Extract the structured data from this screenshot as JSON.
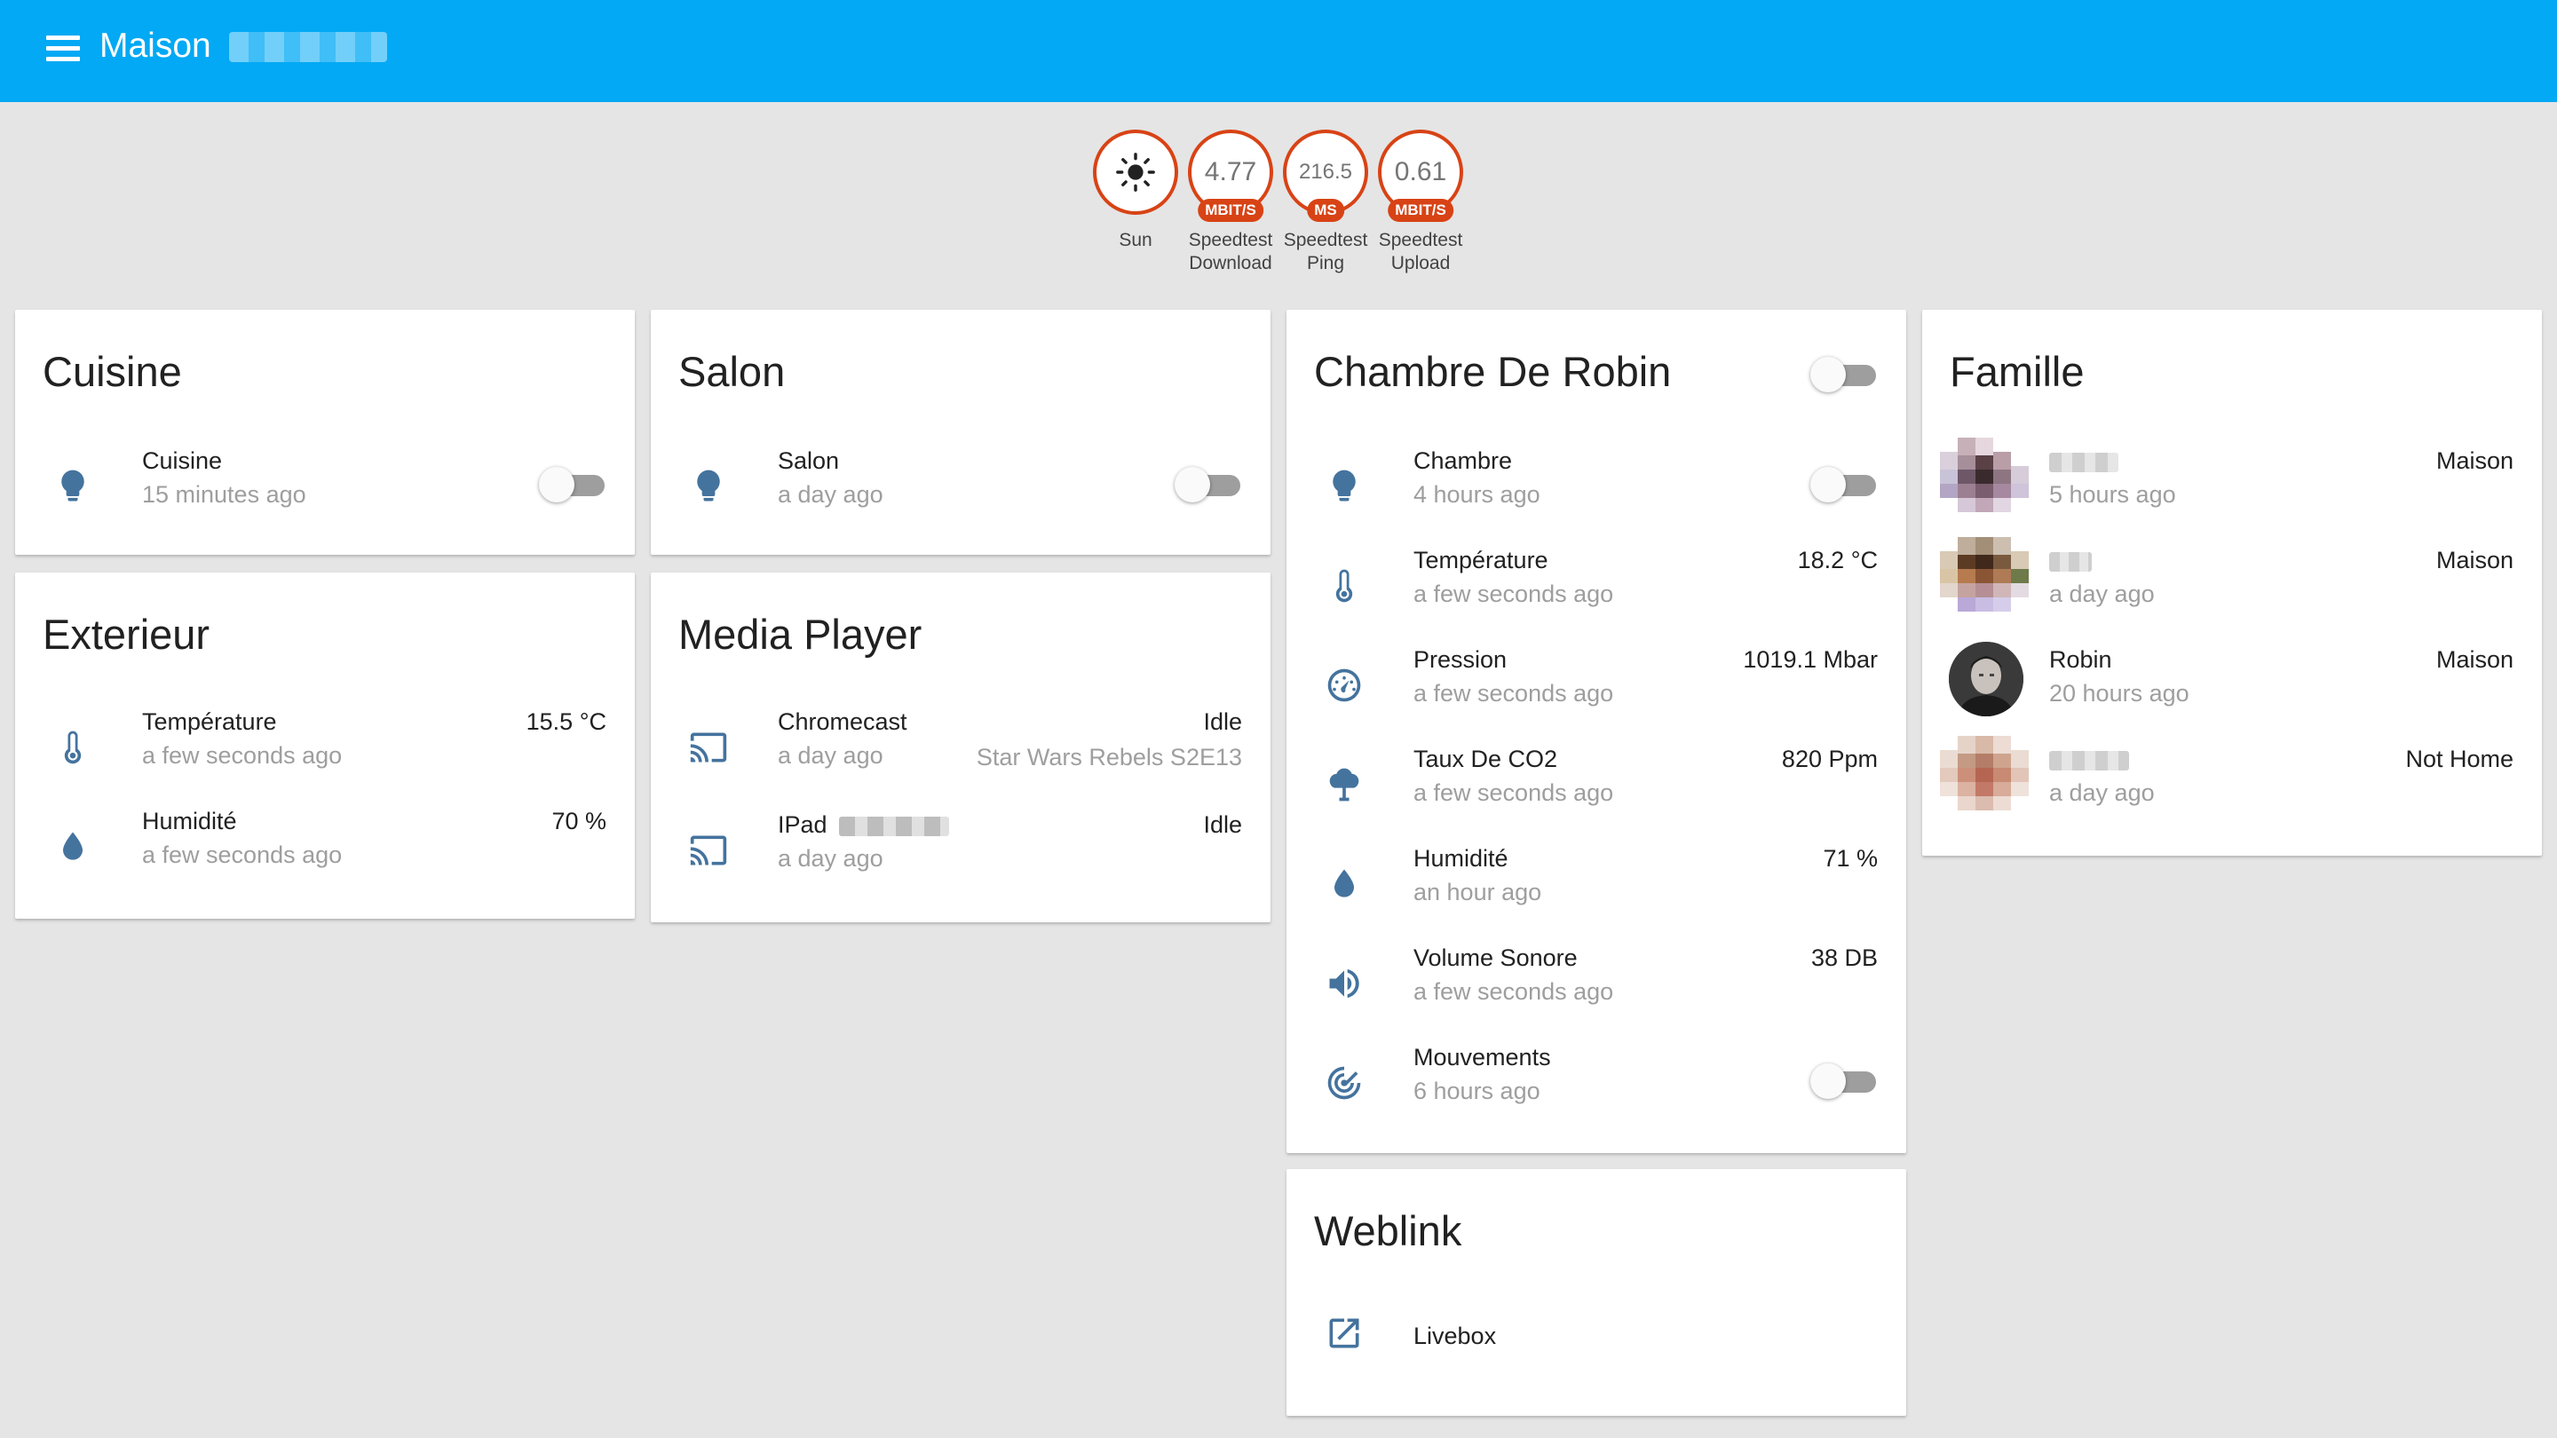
{
  "header": {
    "title": "Maison"
  },
  "badges": [
    {
      "icon": "sun-icon",
      "value": "",
      "unit": "",
      "label": "Sun"
    },
    {
      "value": "4.77",
      "unit": "MBIT/S",
      "label": "Speedtest Download"
    },
    {
      "value": "216.5",
      "unit": "MS",
      "label": "Speedtest Ping"
    },
    {
      "value": "0.61",
      "unit": "MBIT/S",
      "label": "Speedtest Upload"
    }
  ],
  "cards": {
    "cuisine": {
      "title": "Cuisine",
      "rows": [
        {
          "icon": "lightbulb-icon",
          "name": "Cuisine",
          "sub": "15 minutes ago",
          "toggle": "off"
        }
      ]
    },
    "exterieur": {
      "title": "Exterieur",
      "rows": [
        {
          "icon": "thermometer-icon",
          "name": "Température",
          "sub": "a few seconds ago",
          "value": "15.5 °C"
        },
        {
          "icon": "water-drop-icon",
          "name": "Humidité",
          "sub": "a few seconds ago",
          "value": "70 %"
        }
      ]
    },
    "salon": {
      "title": "Salon",
      "rows": [
        {
          "icon": "lightbulb-icon",
          "name": "Salon",
          "sub": "a day ago",
          "toggle": "off"
        }
      ]
    },
    "media": {
      "title": "Media Player",
      "rows": [
        {
          "icon": "cast-icon",
          "name": "Chromecast",
          "sub": "a day ago",
          "value": "Idle",
          "value2": "Star Wars Rebels S2E13"
        },
        {
          "icon": "cast-icon",
          "name": "IPad",
          "sub": "a day ago",
          "value": "Idle"
        }
      ]
    },
    "chambre": {
      "title": "Chambre De Robin",
      "toggle": "off",
      "rows": [
        {
          "icon": "lightbulb-icon",
          "name": "Chambre",
          "sub": "4 hours ago",
          "toggle": "off"
        },
        {
          "icon": "thermometer-icon",
          "name": "Température",
          "sub": "a few seconds ago",
          "value": "18.2 °C"
        },
        {
          "icon": "gauge-icon",
          "name": "Pression",
          "sub": "a few seconds ago",
          "value": "1019.1 Mbar"
        },
        {
          "icon": "cloud-tree-icon",
          "name": "Taux De CO2",
          "sub": "a few seconds ago",
          "value": "820 Ppm"
        },
        {
          "icon": "water-drop-icon",
          "name": "Humidité",
          "sub": "an hour ago",
          "value": "71 %"
        },
        {
          "icon": "speaker-icon",
          "name": "Volume Sonore",
          "sub": "a few seconds ago",
          "value": "38 DB"
        },
        {
          "icon": "motion-radar-icon",
          "name": "Mouvements",
          "sub": "6 hours ago",
          "toggle": "off"
        }
      ]
    },
    "weblink": {
      "title": "Weblink",
      "rows": [
        {
          "icon": "open-in-new-icon",
          "name": "Livebox"
        }
      ]
    },
    "famille": {
      "title": "Famille",
      "rows": [
        {
          "name": "",
          "sub": "5 hours ago",
          "value": "Maison"
        },
        {
          "name": "",
          "sub": "a day ago",
          "value": "Maison"
        },
        {
          "name": "Robin",
          "sub": "20 hours ago",
          "value": "Maison"
        },
        {
          "name": "",
          "sub": "a day ago",
          "value": "Not Home"
        }
      ]
    }
  },
  "colors": {
    "header": "#03a9f4",
    "badge_border": "#d84315",
    "icon": "#44739e",
    "background": "#e5e5e5"
  }
}
